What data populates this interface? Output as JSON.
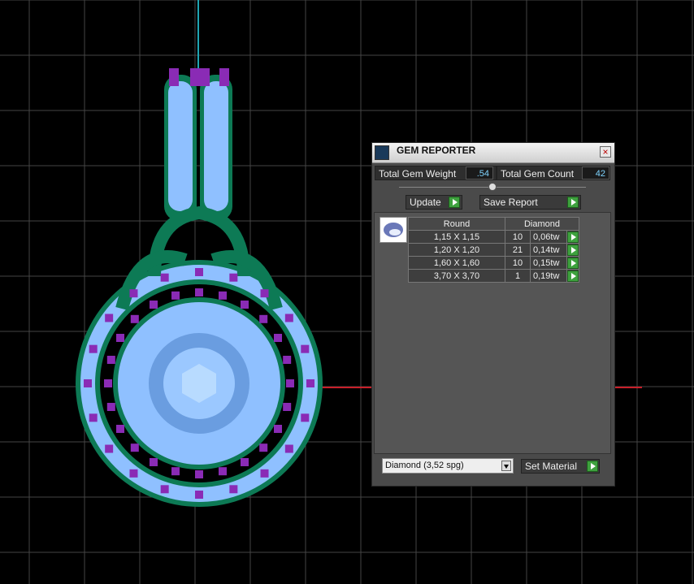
{
  "panel": {
    "title": "GEM REPORTER",
    "total_weight_label": "Total Gem Weight",
    "total_weight_value": ".54",
    "total_count_label": "Total Gem Count",
    "total_count_value": "42",
    "update_label": "Update",
    "save_label": "Save Report",
    "table": {
      "headers": [
        "Round",
        "Diamond"
      ],
      "rows": [
        {
          "size": "1,15 X 1,15",
          "count": "10",
          "weight": "0,06tw"
        },
        {
          "size": "1,20 X 1,20",
          "count": "21",
          "weight": "0,14tw"
        },
        {
          "size": "1,60 X 1,60",
          "count": "10",
          "weight": "0,15tw"
        },
        {
          "size": "3,70 X 3,70",
          "count": "1",
          "weight": "0,19tw"
        }
      ]
    },
    "material_select": "Diamond    (3,52 spg)",
    "set_material_label": "Set Material"
  },
  "colors": {
    "grid": "#4a4a4a",
    "gem": "#8fc0ff",
    "accent": "#8a2bb5",
    "metal": "#0d7a55"
  }
}
